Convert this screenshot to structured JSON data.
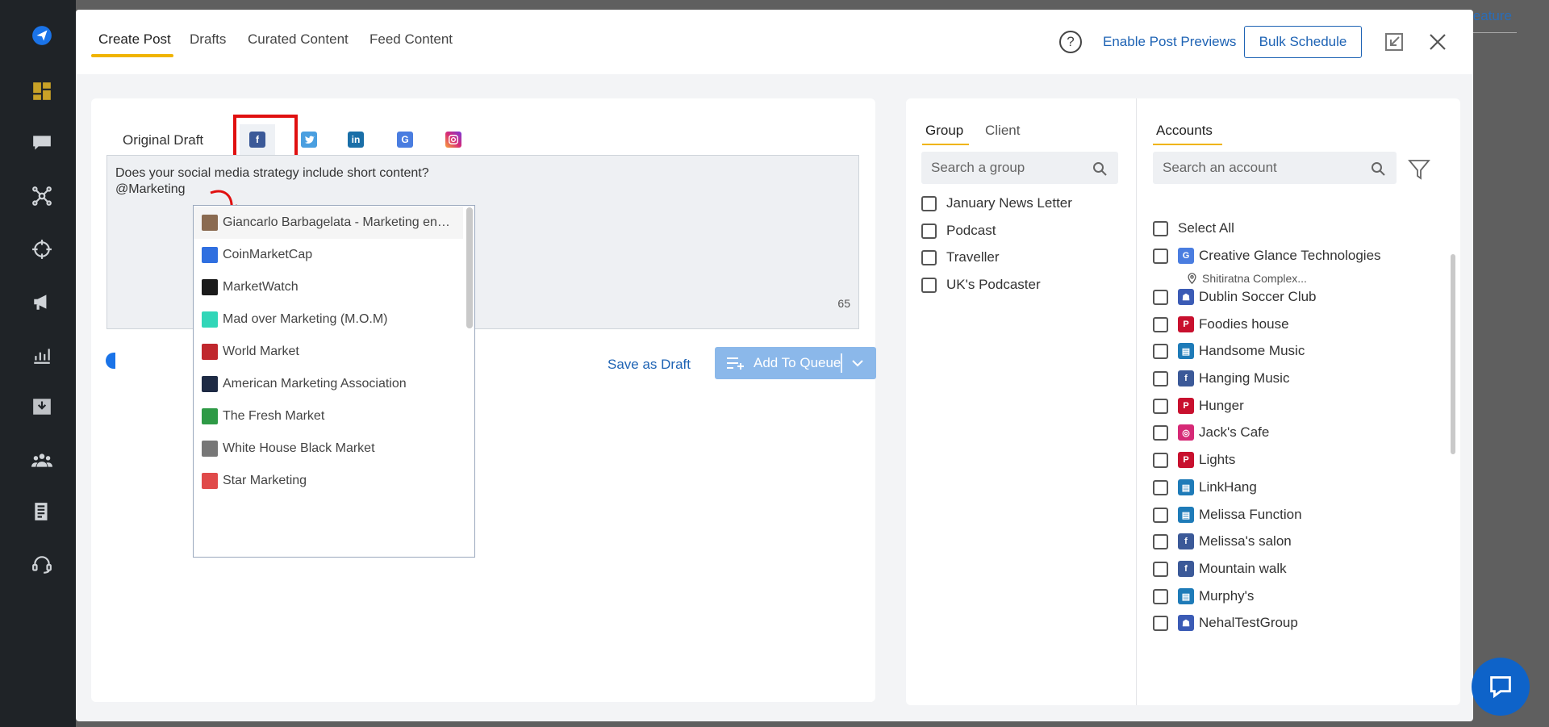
{
  "background": {
    "link_text": "eature"
  },
  "sidebar": {
    "icons": [
      "send-icon",
      "dashboard-icon",
      "chat-icon",
      "network-icon",
      "target-icon",
      "megaphone-icon",
      "analytics-icon",
      "inbox-icon",
      "team-icon",
      "reports-icon",
      "support-icon"
    ]
  },
  "header": {
    "tabs": [
      "Create Post",
      "Drafts",
      "Curated Content",
      "Feed Content"
    ],
    "help_symbol": "?",
    "enable_previews": "Enable Post Previews",
    "bulk_schedule": "Bulk Schedule"
  },
  "editor": {
    "original_draft": "Original Draft",
    "network_tabs": [
      "facebook",
      "twitter",
      "linkedin",
      "google-business",
      "instagram"
    ],
    "text_line1": "Does your social media strategy include short content?",
    "text_line2": "@Marketing",
    "char_count": "65",
    "save_as_draft": "Save as Draft",
    "add_to_queue": "Add To Queue"
  },
  "mention_dropdown": {
    "items": [
      "Giancarlo Barbagelata - Marketing en…",
      "CoinMarketCap",
      "MarketWatch",
      "Mad over Marketing (M.O.M)",
      "World Market",
      "American Marketing Association",
      "The Fresh Market",
      "White House Black Market",
      "Star Marketing"
    ],
    "avatar_colors": [
      "#8a6a50",
      "#2f6fe0",
      "#1a1a1a",
      "#31d6b8",
      "#c0272d",
      "#1e2a44",
      "#2e9a46",
      "#777777",
      "#e04a4a"
    ]
  },
  "group_panel": {
    "tabs": [
      "Group",
      "Client"
    ],
    "search_placeholder": "Search a group",
    "groups": [
      "January News Letter",
      "Podcast",
      "Traveller",
      "UK's Podcaster"
    ]
  },
  "accounts_panel": {
    "title": "Accounts",
    "search_placeholder": "Search an account",
    "select_all": "Select All",
    "accounts": [
      {
        "name": "Creative Glance Technologies",
        "type": "google-business",
        "color": "#4a7de0"
      },
      {
        "name": "Dublin Soccer Club",
        "type": "facebook-group",
        "color": "#3b5bb5"
      },
      {
        "name": "Foodies house",
        "type": "pinterest",
        "color": "#c8102e"
      },
      {
        "name": "Handsome Music",
        "type": "linkedin-page",
        "color": "#1e7bb8"
      },
      {
        "name": "Hanging Music",
        "type": "facebook",
        "color": "#3b5998"
      },
      {
        "name": "Hunger",
        "type": "pinterest",
        "color": "#c8102e"
      },
      {
        "name": "Jack's Cafe",
        "type": "instagram",
        "color": "#d62976"
      },
      {
        "name": "Lights",
        "type": "pinterest",
        "color": "#c8102e"
      },
      {
        "name": "LinkHang",
        "type": "linkedin-page",
        "color": "#1e7bb8"
      },
      {
        "name": "Melissa Function",
        "type": "linkedin-page",
        "color": "#1e7bb8"
      },
      {
        "name": "Melissa's salon",
        "type": "facebook",
        "color": "#3b5998"
      },
      {
        "name": "Mountain walk",
        "type": "facebook",
        "color": "#3b5998"
      },
      {
        "name": "Murphy's",
        "type": "linkedin-page",
        "color": "#1e7bb8"
      },
      {
        "name": "NehalTestGroup",
        "type": "facebook-group",
        "color": "#3b5bb5"
      }
    ],
    "location": "Shitiratna Complex..."
  }
}
